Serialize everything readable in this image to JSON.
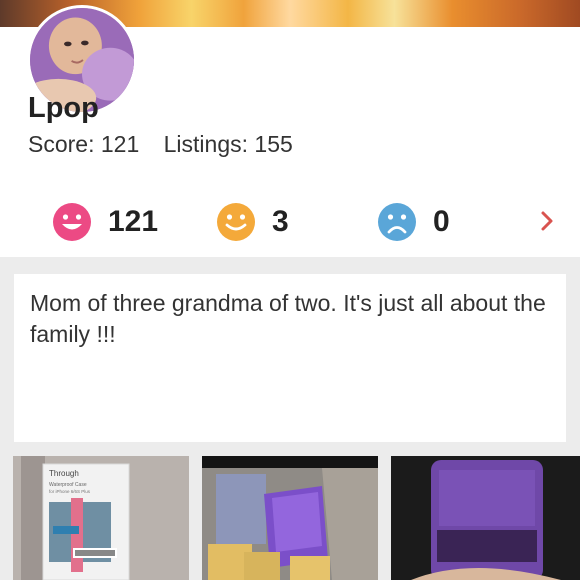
{
  "profile": {
    "username": "Lpop",
    "score_label": "Score: 121",
    "listings_label": "Listings: 155"
  },
  "ratings": {
    "positive": "121",
    "neutral": "3",
    "negative": "0"
  },
  "bio": {
    "text": "Mom of three grandma of two. It's just all about the family !!!"
  },
  "listing_tile_1": {
    "brand": "Through",
    "line1": "Waterproof Case",
    "line2": "for iPhone 6/6S Plus"
  },
  "colors": {
    "positive": "#ec4a84",
    "neutral": "#f4a93a",
    "negative": "#5aa6d8",
    "chevron": "#d9534f"
  }
}
